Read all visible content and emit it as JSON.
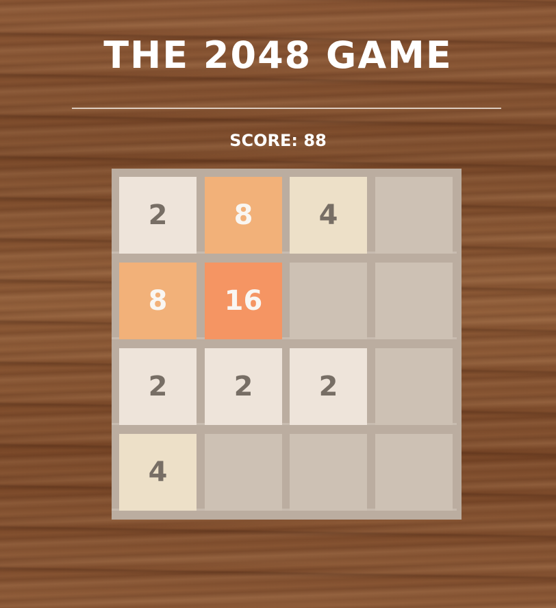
{
  "header": {
    "title": "THE 2048 GAME",
    "score_label": "SCORE: 88"
  },
  "colors": {
    "board": "#bbada0",
    "empty": "#cdc1b4",
    "tile_2": "#eee4da",
    "tile_4": "#ede0c8",
    "tile_8": "#f2b179",
    "tile_16": "#f59563",
    "dark_text": "#776e65",
    "light_text": "#f9f6f2"
  },
  "board": {
    "rows": [
      {
        "cells": [
          "2",
          "8",
          "4",
          ""
        ]
      },
      {
        "cells": [
          "8",
          "16",
          "",
          ""
        ]
      },
      {
        "cells": [
          "2",
          "2",
          "2",
          ""
        ]
      },
      {
        "cells": [
          "4",
          "",
          "",
          ""
        ]
      }
    ]
  }
}
